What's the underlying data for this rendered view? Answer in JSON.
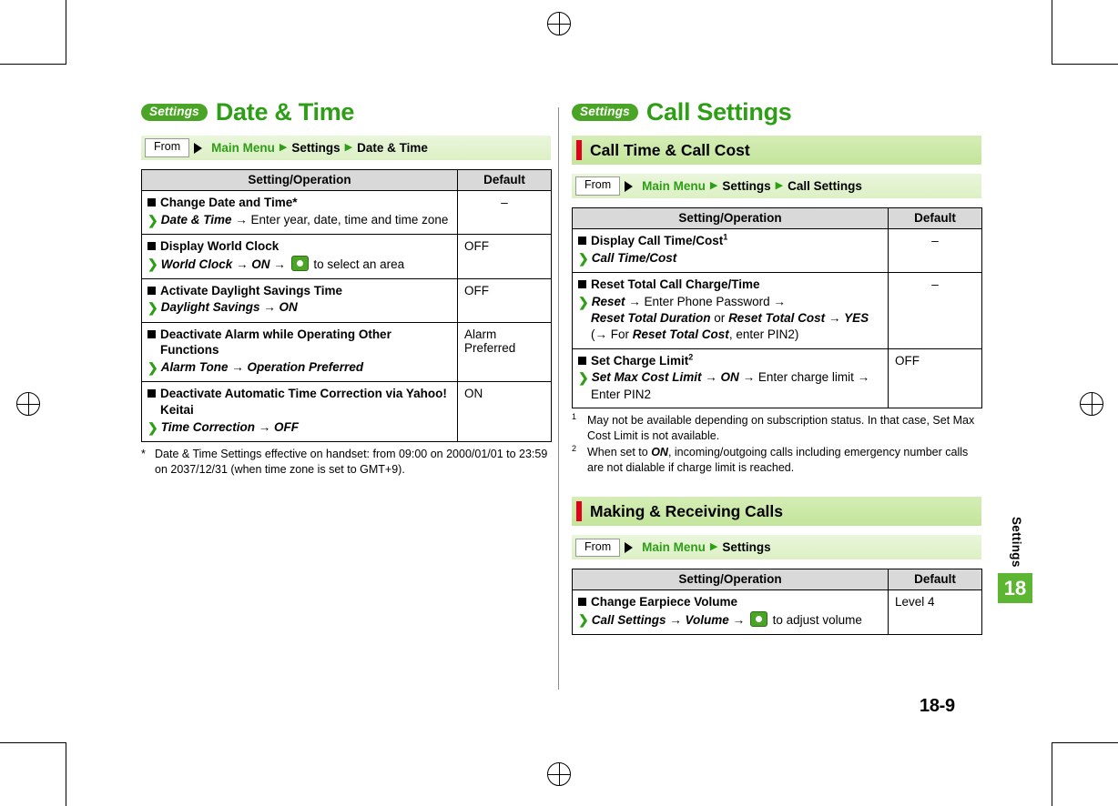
{
  "left": {
    "badge": "Settings",
    "chapter_title": "Date & Time",
    "from": {
      "label": "From",
      "p1": "Main Menu",
      "p2": "Settings",
      "p3": "Date & Time"
    },
    "table": {
      "headers": [
        "Setting/Operation",
        "Default"
      ],
      "rows": [
        {
          "title": "Change Date and Time*",
          "steps": [
            {
              "bold": "Date & Time",
              "arrow": "→",
              "plain": "Enter year, date, time and time zone"
            }
          ],
          "default": "–",
          "default_center": true
        },
        {
          "title": "Display World Clock",
          "steps": [
            {
              "bold": "World Clock",
              "arrow": "→",
              "bold2": "ON",
              "arrow2": "→",
              "icon": "dpad-key-icon",
              "plain": "to select an area"
            }
          ],
          "default": "OFF",
          "default_center": false
        },
        {
          "title": "Activate Daylight Savings Time",
          "steps": [
            {
              "bold": "Daylight Savings",
              "arrow": "→",
              "bold2": "ON"
            }
          ],
          "default": "OFF",
          "default_center": false
        },
        {
          "title": "Deactivate Alarm while Operating Other Functions",
          "steps": [
            {
              "bold": "Alarm Tone",
              "arrow": "→",
              "bold2": "Operation Preferred"
            }
          ],
          "default": "Alarm Preferred",
          "default_center": false
        },
        {
          "title": "Deactivate Automatic Time Correction via Yahoo! Keitai",
          "steps": [
            {
              "bold": "Time Correction",
              "arrow": "→",
              "bold2": "OFF"
            }
          ],
          "default": "ON",
          "default_center": false
        }
      ]
    },
    "footnote": {
      "mark": "*",
      "text": "Date & Time Settings effective on handset: from 09:00 on 2000/01/01 to 23:59 on 2037/12/31 (when time zone is set to GMT+9)."
    }
  },
  "right": {
    "badge": "Settings",
    "chapter_title": "Call Settings",
    "section1": {
      "title": "Call Time & Call Cost",
      "from": {
        "label": "From",
        "p1": "Main Menu",
        "p2": "Settings",
        "p3": "Call Settings"
      },
      "table": {
        "headers": [
          "Setting/Operation",
          "Default"
        ],
        "rows": [
          {
            "title": "Display Call Time/Cost",
            "title_sup": "1",
            "steps": [
              {
                "bold": "Call Time/Cost"
              }
            ],
            "default": "–",
            "default_center": true
          },
          {
            "title": "Reset Total Call Charge/Time",
            "steps": [
              {
                "bold": "Reset",
                "arrow": "→",
                "plain": "Enter Phone Password",
                "arrow_end": "→"
              },
              {
                "indent": true,
                "bold": "Reset Total Duration",
                "plain_mid": "or",
                "bold2": "Reset Total Cost",
                "arrow2": "→",
                "bold3": "YES"
              },
              {
                "indent": true,
                "paren_open": "(",
                "arrow3": "→",
                "plain2": "For",
                "bold4": "Reset Total Cost",
                "plain3": ", enter PIN2)"
              }
            ],
            "default": "–",
            "default_center": true
          },
          {
            "title": "Set Charge Limit",
            "title_sup": "2",
            "steps": [
              {
                "bold": "Set Max Cost Limit",
                "arrow": "→",
                "bold2": "ON",
                "arrow2": "→",
                "plain": "Enter charge limit",
                "arrow_end": "→"
              },
              {
                "indent": true,
                "plain": "Enter PIN2"
              }
            ],
            "default": "OFF",
            "default_center": false
          }
        ]
      },
      "footnotes": [
        {
          "mark": "1",
          "text": "May not be available depending on subscription status. In that case, Set Max Cost Limit is not available."
        },
        {
          "mark": "2",
          "pre": "When set to ",
          "bold": "ON",
          "post": ", incoming/outgoing calls including emergency number calls are not dialable if charge limit is reached."
        }
      ]
    },
    "section2": {
      "title": "Making & Receiving Calls",
      "from": {
        "label": "From",
        "p1": "Main Menu",
        "p2": "Settings"
      },
      "table": {
        "headers": [
          "Setting/Operation",
          "Default"
        ],
        "rows": [
          {
            "title": "Change Earpiece Volume",
            "steps": [
              {
                "bold": "Call Settings",
                "arrow": "→",
                "bold2": "Volume",
                "arrow2": "→",
                "icon": "dpad-key-icon",
                "plain": "to adjust volume"
              }
            ],
            "default": "Level 4",
            "default_center": false
          }
        ]
      }
    }
  },
  "side": {
    "chapter_label": "Settings",
    "chapter_number": "18"
  },
  "page_number": "18-9",
  "colors": {
    "green": "#2e9e16",
    "badge_green": "#4aa526",
    "section_bar": "#c3e59b",
    "accent_red": "#e2001a",
    "table_header": "#d9d9d9"
  }
}
